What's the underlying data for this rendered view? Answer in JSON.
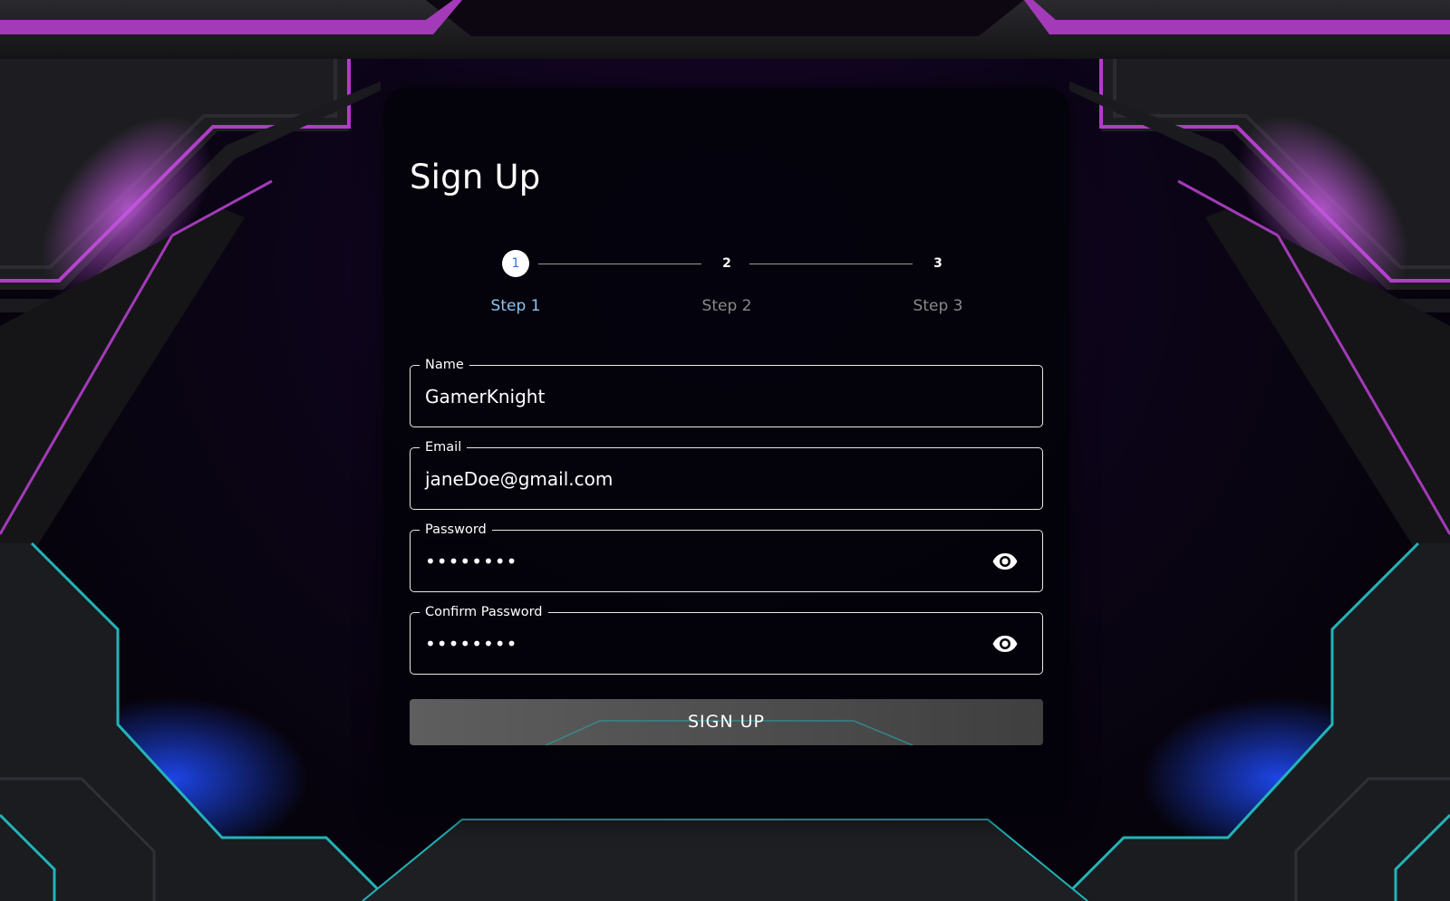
{
  "form": {
    "title": "Sign Up",
    "steps": [
      {
        "number": "1",
        "label": "Step 1",
        "state": "active"
      },
      {
        "number": "2",
        "label": "Step 2",
        "state": "inactive"
      },
      {
        "number": "3",
        "label": "Step 3",
        "state": "inactive"
      }
    ],
    "fields": {
      "name": {
        "label": "Name",
        "value": "GamerKnight"
      },
      "email": {
        "label": "Email",
        "value": "janeDoe@gmail.com"
      },
      "password": {
        "label": "Password",
        "value": "••••••••"
      },
      "confirm_password": {
        "label": "Confirm Password",
        "value": "••••••••"
      }
    },
    "submit_label": "SIGN UP"
  },
  "icons": {
    "password_toggle": "eye-icon",
    "confirm_password_toggle": "eye-icon"
  },
  "colors": {
    "accent_purple": "#b03cc8",
    "accent_teal": "#23b3b8",
    "active_step_text": "#8fc3f0",
    "button_bg": "#555555"
  }
}
